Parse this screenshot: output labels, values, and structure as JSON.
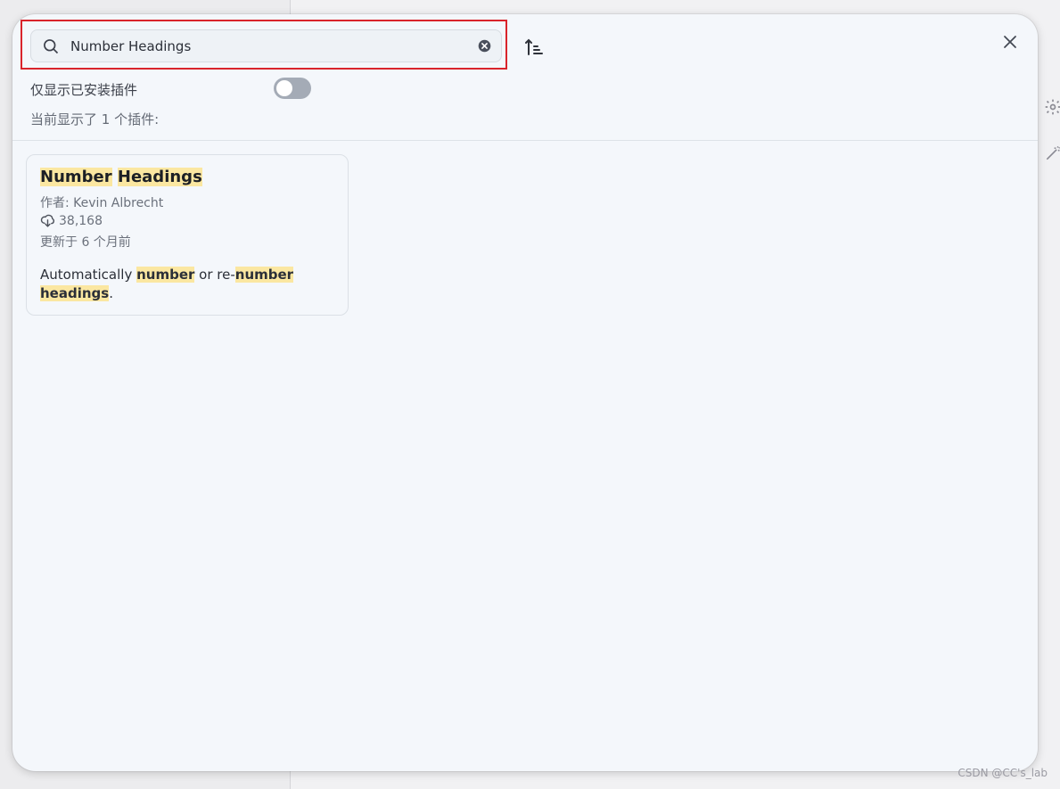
{
  "search": {
    "value": "Number Headings",
    "placeholder": ""
  },
  "filters": {
    "installed_only_label": "仅显示已安装插件",
    "installed_only_enabled": false,
    "count_text": "当前显示了 1 个插件:"
  },
  "icons": {
    "search": "search-icon",
    "clear": "clear-search-icon",
    "sort": "sort-icon",
    "close": "close-icon",
    "downloads": "download-cloud-icon",
    "bg_gear": "gear-icon",
    "bg_wand": "magic-wand-icon"
  },
  "plugins": [
    {
      "title_parts": [
        "Number",
        "Headings"
      ],
      "author_label": "作者:",
      "author": "Kevin Albrecht",
      "downloads": "38,168",
      "updated": "更新于 6 个月前",
      "desc": {
        "t1": "Automatically ",
        "h1": "number",
        "t2": " or re-",
        "h2": "number",
        "t3": " ",
        "h3": "headings",
        "t4": "."
      }
    }
  ],
  "colors": {
    "highlight": "#fbe7a1",
    "annotation_box": "#d9242b",
    "modal_bg": "#f4f7fb",
    "toggle_off": "#a4abb6"
  },
  "watermark": "CSDN @CC's_lab"
}
